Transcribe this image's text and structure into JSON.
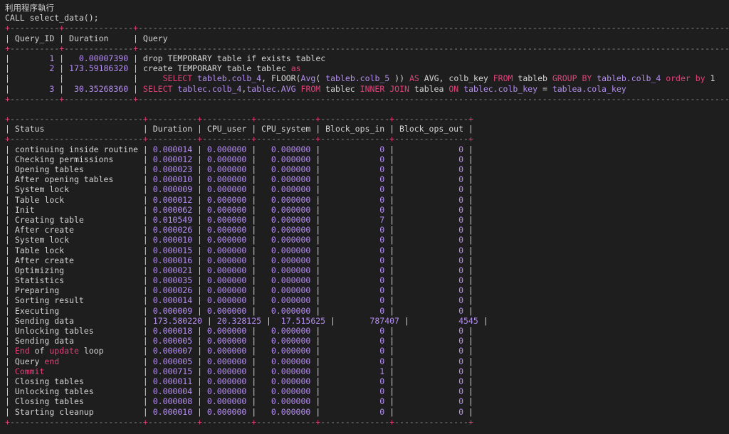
{
  "header": {
    "title": "利用程序執行",
    "call": "CALL select_data();"
  },
  "query_table": {
    "columns": [
      "Query_ID",
      "Duration",
      "Query"
    ],
    "rows": [
      {
        "id": "1",
        "duration": "0.00007390",
        "query": "drop TEMPORARY table if exists tablec"
      },
      {
        "id": "2",
        "duration": "173.59186320",
        "query": "create TEMPORARY table tablec as",
        "query_cont": "SELECT tableb.colb_4, FLOOR(Avg( tableb.colb_5 )) AS AVG, colb_key FROM tableb GROUP BY tableb.colb_4 order by 1"
      },
      {
        "id": "3",
        "duration": "30.35268360",
        "query": "SELECT tablec.colb_4,tablec.AVG FROM tablec INNER JOIN tablea ON tablec.colb_key = tablea.cola_key"
      }
    ]
  },
  "status_table": {
    "columns": [
      "Status",
      "Duration",
      "CPU_user",
      "CPU_system",
      "Block_ops_in",
      "Block_ops_out"
    ],
    "rows": [
      [
        "continuing inside routine",
        "0.000014",
        "0.000000",
        "0.000000",
        "0",
        "0"
      ],
      [
        "Checking permissions",
        "0.000012",
        "0.000000",
        "0.000000",
        "0",
        "0"
      ],
      [
        "Opening tables",
        "0.000023",
        "0.000000",
        "0.000000",
        "0",
        "0"
      ],
      [
        "After opening tables",
        "0.000010",
        "0.000000",
        "0.000000",
        "0",
        "0"
      ],
      [
        "System lock",
        "0.000009",
        "0.000000",
        "0.000000",
        "0",
        "0"
      ],
      [
        "Table lock",
        "0.000012",
        "0.000000",
        "0.000000",
        "0",
        "0"
      ],
      [
        "Init",
        "0.000062",
        "0.000000",
        "0.000000",
        "0",
        "0"
      ],
      [
        "Creating table",
        "0.010549",
        "0.000000",
        "0.000000",
        "7",
        "0"
      ],
      [
        "After create",
        "0.000026",
        "0.000000",
        "0.000000",
        "0",
        "0"
      ],
      [
        "System lock",
        "0.000010",
        "0.000000",
        "0.000000",
        "0",
        "0"
      ],
      [
        "Table lock",
        "0.000015",
        "0.000000",
        "0.000000",
        "0",
        "0"
      ],
      [
        "After create",
        "0.000016",
        "0.000000",
        "0.000000",
        "0",
        "0"
      ],
      [
        "Optimizing",
        "0.000021",
        "0.000000",
        "0.000000",
        "0",
        "0"
      ],
      [
        "Statistics",
        "0.000035",
        "0.000000",
        "0.000000",
        "0",
        "0"
      ],
      [
        "Preparing",
        "0.000026",
        "0.000000",
        "0.000000",
        "0",
        "0"
      ],
      [
        "Sorting result",
        "0.000014",
        "0.000000",
        "0.000000",
        "0",
        "0"
      ],
      [
        "Executing",
        "0.000009",
        "0.000000",
        "0.000000",
        "0",
        "0"
      ],
      [
        "Sending data",
        "173.580220",
        "20.328125",
        "17.515625",
        "787407",
        "4545"
      ],
      [
        "Unlocking tables",
        "0.000018",
        "0.000000",
        "0.000000",
        "0",
        "0"
      ],
      [
        "Sending data",
        "0.000005",
        "0.000000",
        "0.000000",
        "0",
        "0"
      ],
      [
        "End of update loop",
        "0.000007",
        "0.000000",
        "0.000000",
        "0",
        "0"
      ],
      [
        "Query end",
        "0.000005",
        "0.000000",
        "0.000000",
        "0",
        "0"
      ],
      [
        "Commit",
        "0.000715",
        "0.000000",
        "0.000000",
        "1",
        "0"
      ],
      [
        "Closing tables",
        "0.000011",
        "0.000000",
        "0.000000",
        "0",
        "0"
      ],
      [
        "Unlocking tables",
        "0.000004",
        "0.000000",
        "0.000000",
        "0",
        "0"
      ],
      [
        "Closing tables",
        "0.000008",
        "0.000000",
        "0.000000",
        "0",
        "0"
      ],
      [
        "Starting cleanup",
        "0.000010",
        "0.000000",
        "0.000000",
        "0",
        "0"
      ]
    ]
  },
  "colors": {
    "background": "#1e1e1e",
    "text": "#d4d4d4",
    "number": "#b48ef0",
    "keyword": "#e0427a",
    "border": "#8a8a8a"
  }
}
